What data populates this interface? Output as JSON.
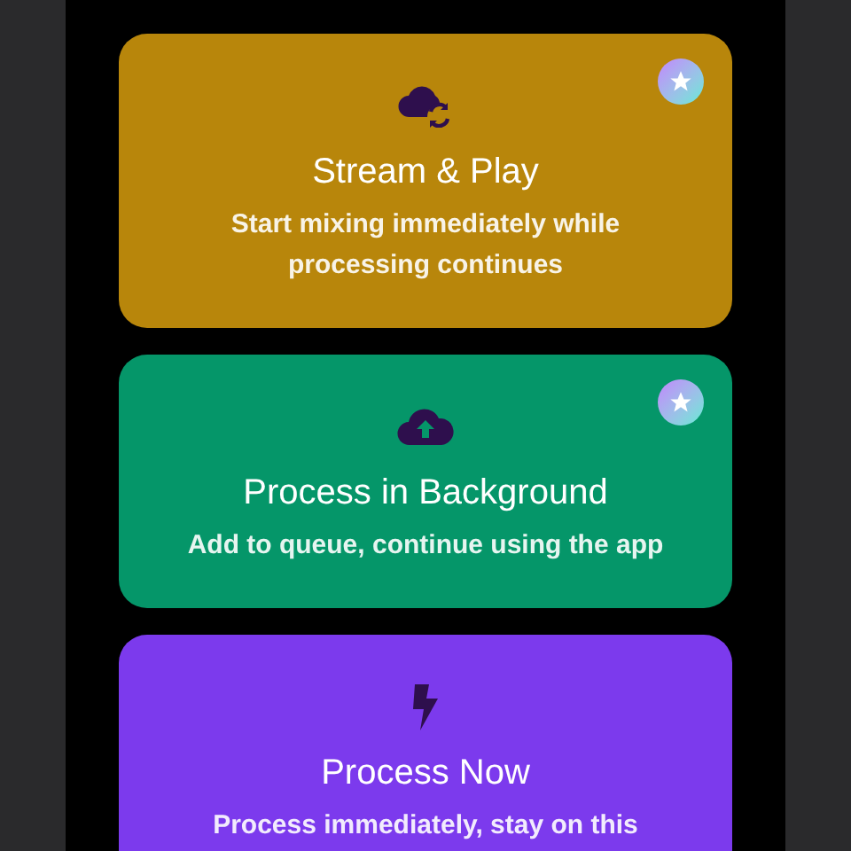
{
  "options": [
    {
      "kind": "stream",
      "title": "Stream & Play",
      "subtitle": "Start mixing immediately while processing continues",
      "color": "#b8860b",
      "premium": true
    },
    {
      "kind": "background",
      "title": "Process in Background",
      "subtitle": "Add to queue, continue using the app",
      "color": "#059669",
      "premium": true
    },
    {
      "kind": "now",
      "title": "Process Now",
      "subtitle": "Process immediately, stay on this",
      "color": "#7c3aed",
      "premium": false
    }
  ]
}
